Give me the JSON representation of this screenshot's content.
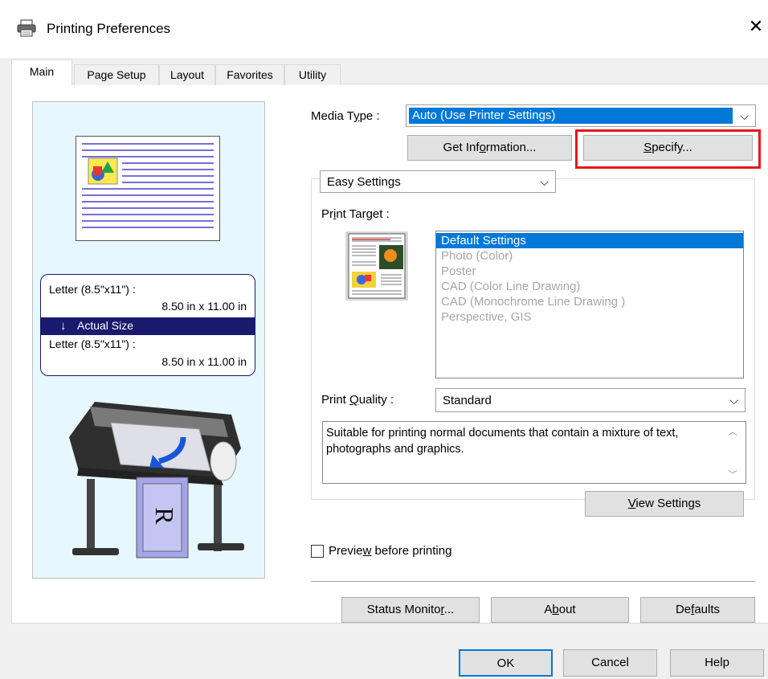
{
  "window": {
    "title": "Printing Preferences",
    "close_glyph": "✕"
  },
  "tabs": [
    {
      "label": "Main"
    },
    {
      "label": "Page Setup"
    },
    {
      "label": "Layout"
    },
    {
      "label": "Favorites"
    },
    {
      "label": "Utility"
    }
  ],
  "preview": {
    "input_paper_label": "Letter (8.5\"x11\") :",
    "input_paper_size": "8.50 in x 11.00 in",
    "scaling_label": "Actual Size",
    "output_paper_label": "Letter (8.5\"x11\") :",
    "output_paper_size": "8.50 in x 11.00 in",
    "printer_paper_letter": "R"
  },
  "media_type": {
    "label_pre": "Media T",
    "label_u": "y",
    "label_post": "pe :",
    "value": "Auto (Use Printer Settings)"
  },
  "buttons": {
    "get_info": {
      "pre": "Get Inf",
      "u": "o",
      "post": "rmation..."
    },
    "specify": {
      "pre": "",
      "u": "S",
      "post": "pecify..."
    },
    "view_settings": {
      "pre": "",
      "u": "V",
      "post": "iew Settings"
    },
    "status_monitor": {
      "pre": "Status Monito",
      "u": "r",
      "post": "..."
    },
    "about": {
      "pre": "A",
      "u": "b",
      "post": "out"
    },
    "defaults": {
      "pre": "De",
      "u": "f",
      "post": "aults"
    },
    "ok": "OK",
    "cancel": "Cancel",
    "help": "Help"
  },
  "settings_mode": {
    "value": "Easy Settings"
  },
  "print_target": {
    "label_pre": "Pr",
    "label_u": "i",
    "label_post": "nt Target :",
    "items": [
      "Default Settings",
      "Photo (Color)",
      "Poster",
      "CAD (Color Line Drawing)",
      "CAD (Monochrome Line Drawing )",
      "Perspective, GIS"
    ],
    "selected_index": 0
  },
  "print_quality": {
    "label_pre": "Print ",
    "label_u": "Q",
    "label_post": "uality :",
    "value": "Standard",
    "description": "Suitable for printing normal documents that contain a mixture of text, photographs and graphics."
  },
  "preview_checkbox": {
    "label_pre": "Previe",
    "label_u": "w",
    "label_post": " before printing",
    "checked": false
  },
  "colors": {
    "selection": "#0078d7",
    "highlight_frame": "#e8161c",
    "preview_bg": "#e6f7ff",
    "info_bar": "#1a1a6e"
  }
}
